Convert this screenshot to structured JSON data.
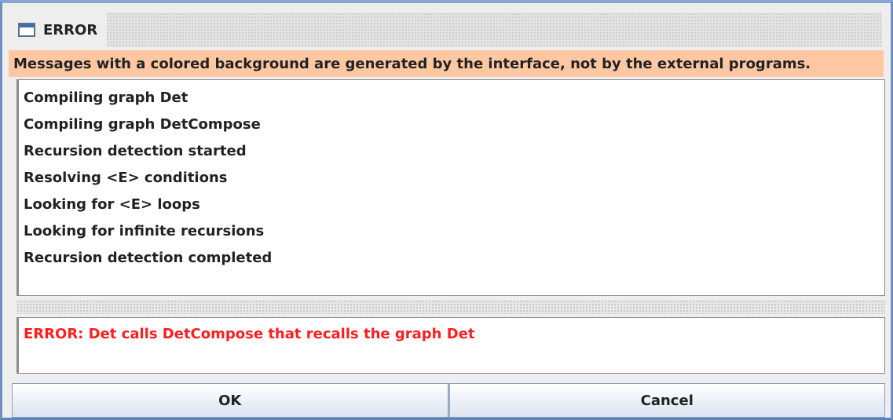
{
  "window": {
    "title": "ERROR"
  },
  "info_banner": {
    "text": "Messages with a colored background are generated by the interface, not by the external programs."
  },
  "log": {
    "lines": [
      "Compiling graph Det",
      "Compiling graph DetCompose",
      "Recursion detection started",
      "Resolving <E> conditions",
      "Looking for <E> loops",
      "Looking for infinite recursions",
      "Recursion detection completed"
    ]
  },
  "errors": {
    "message": "ERROR: Det calls DetCompose that recalls the graph Det"
  },
  "buttons": {
    "ok": "OK",
    "cancel": "Cancel"
  },
  "icons": {
    "window": "window-icon"
  },
  "colors": {
    "banner_bg": "#ffc8a3",
    "error_text": "#ff1e1e"
  }
}
